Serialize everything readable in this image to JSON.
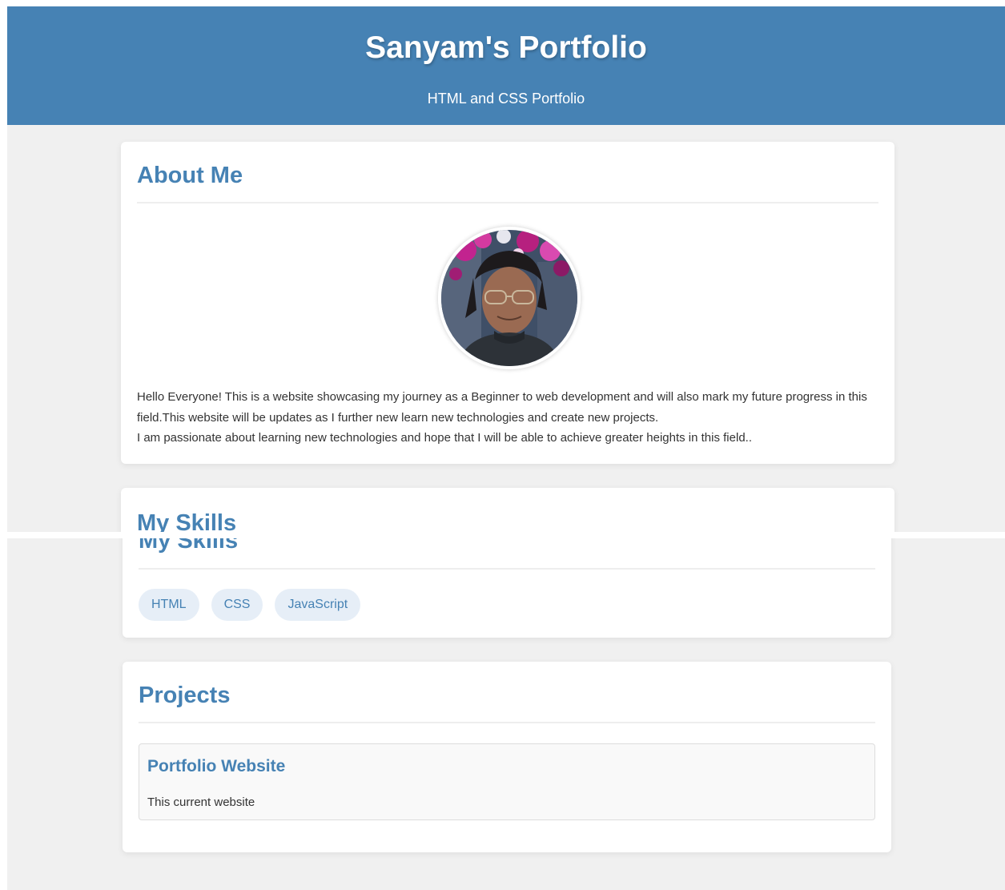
{
  "header": {
    "title": "Sanyam's Portfolio",
    "subtitle": "HTML and CSS Portfolio"
  },
  "about": {
    "heading": "About Me",
    "avatar_icon": "profile-photo",
    "paragraphs": [
      "Hello Everyone! This is a website showcasing my journey as a Beginner to web development and will also mark my future progress in this field.This website will be updates as I further new learn new technologies and create new projects.",
      "I am passionate about learning new technologies and hope that I will be able to achieve greater heights in this field.."
    ]
  },
  "skills": {
    "heading": "My Skills",
    "items": [
      "HTML",
      "CSS",
      "JavaScript"
    ]
  },
  "projects": {
    "heading": "Projects",
    "items": [
      {
        "title": "Portfolio Website",
        "description": "This current website"
      }
    ]
  },
  "colors": {
    "brand": "#4682b4",
    "background": "#f0f0f0",
    "card": "#ffffff",
    "chip": "#e6eef7",
    "text": "#333333"
  }
}
